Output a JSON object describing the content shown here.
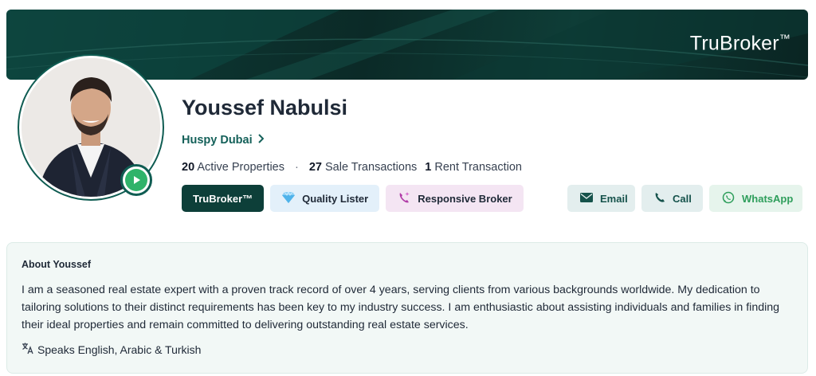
{
  "banner": {
    "logo_text": "TruBroker",
    "logo_mark": "™"
  },
  "profile": {
    "name": "Youssef Nabulsi",
    "agency": "Huspy Dubai",
    "stats": [
      {
        "count": "20",
        "label": "Active Properties"
      },
      {
        "count": "27",
        "label": "Sale Transactions"
      },
      {
        "count": "1",
        "label": "Rent Transaction"
      }
    ],
    "stat_separator": "·"
  },
  "badges": {
    "trubroker": "TruBroker™",
    "quality": "Quality Lister",
    "responsive": "Responsive Broker"
  },
  "actions": {
    "email": "Email",
    "call": "Call",
    "whatsapp": "WhatsApp"
  },
  "about": {
    "title": "About Youssef",
    "text": "I am a seasoned real estate expert with a proven track record of over 4 years, serving clients from various backgrounds worldwide. My dedication to tailoring solutions to their distinct requirements has been key to my industry success. I am enthusiastic about assisting individuals and families in finding their ideal properties and remain committed to delivering outstanding real estate services.",
    "languages": "Speaks English, Arabic & Turkish"
  },
  "colors": {
    "brand_dark": "#0d3f39",
    "brand_link": "#15615a",
    "whatsapp_green": "#2e9e5b",
    "play_green": "#2fb36a"
  },
  "icons": {
    "agency_arrow": "chevron-right-icon",
    "quality": "diamond-icon",
    "responsive": "phone-sparkle-icon",
    "email": "envelope-icon",
    "call": "phone-icon",
    "whatsapp": "whatsapp-icon",
    "language": "translate-icon",
    "video": "play-icon"
  }
}
